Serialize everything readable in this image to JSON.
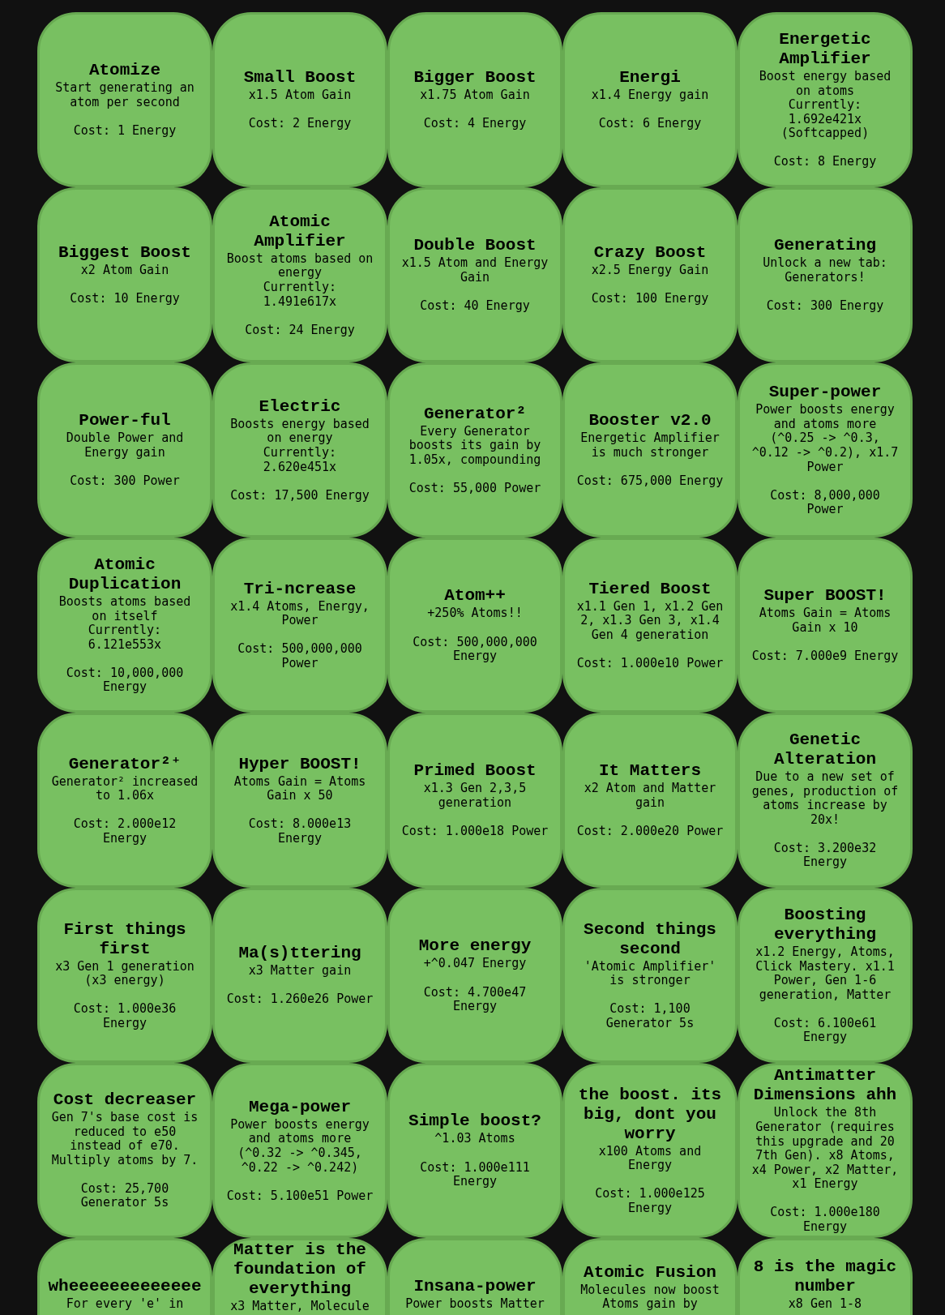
{
  "upgrades": [
    {
      "title": "Atomize",
      "description": "Start generating an atom per second",
      "cost": "Cost: 1 Energy"
    },
    {
      "title": "Small Boost",
      "description": "x1.5 Atom Gain",
      "cost": "Cost: 2 Energy"
    },
    {
      "title": "Bigger Boost",
      "description": "x1.75 Atom Gain",
      "cost": "Cost: 4 Energy"
    },
    {
      "title": "Energi",
      "description": "x1.4 Energy gain",
      "cost": "Cost: 6 Energy"
    },
    {
      "title": "Energetic Amplifier",
      "description": "Boost energy based on atoms",
      "effect": "Currently: 1.692e421x (Softcapped)",
      "cost": "Cost: 8 Energy"
    },
    {
      "title": "Biggest Boost",
      "description": "x2 Atom Gain",
      "cost": "Cost: 10 Energy"
    },
    {
      "title": "Atomic Amplifier",
      "description": "Boost atoms based on energy",
      "effect": "Currently: 1.491e617x",
      "cost": "Cost: 24 Energy"
    },
    {
      "title": "Double Boost",
      "description": "x1.5 Atom and Energy Gain",
      "cost": "Cost: 40 Energy"
    },
    {
      "title": "Crazy Boost",
      "description": "x2.5 Energy Gain",
      "cost": "Cost: 100 Energy"
    },
    {
      "title": "Generating",
      "description": "Unlock a new tab: Generators!",
      "cost": "Cost: 300 Energy"
    },
    {
      "title": "Power-ful",
      "description": "Double Power and Energy gain",
      "cost": "Cost: 300 Power"
    },
    {
      "title": "Electric",
      "description": "Boosts energy based on energy",
      "effect": "Currently: 2.620e451x",
      "cost": "Cost: 17,500 Energy"
    },
    {
      "title": "Generator²",
      "description": "Every Generator boosts its gain by 1.05x, compounding",
      "cost": "Cost: 55,000 Power"
    },
    {
      "title": "Booster v2.0",
      "description": "Energetic Amplifier is much stronger",
      "cost": "Cost: 675,000 Energy"
    },
    {
      "title": "Super-power",
      "description": "Power boosts energy and atoms more (^0.25 -> ^0.3, ^0.12 -> ^0.2), x1.7 Power",
      "cost": "Cost: 8,000,000 Power"
    },
    {
      "title": "Atomic Duplication",
      "description": "Boosts atoms based on itself",
      "effect": "Currently: 6.121e553x",
      "cost": "Cost: 10,000,000 Energy"
    },
    {
      "title": "Tri-ncrease",
      "description": "x1.4 Atoms, Energy, Power",
      "cost": "Cost: 500,000,000 Power"
    },
    {
      "title": "Atom++",
      "description": "+250% Atoms!!",
      "cost": "Cost: 500,000,000 Energy"
    },
    {
      "title": "Tiered Boost",
      "description": "x1.1 Gen 1, x1.2 Gen 2, x1.3 Gen 3, x1.4 Gen 4 generation",
      "cost": "Cost: 1.000e10 Power"
    },
    {
      "title": "Super BOOST!",
      "description": "Atoms Gain = Atoms Gain x 10",
      "cost": "Cost: 7.000e9 Energy"
    },
    {
      "title": "Generator²⁺",
      "description": "Generator² increased to 1.06x",
      "cost": "Cost: 2.000e12 Energy"
    },
    {
      "title": "Hyper BOOST!",
      "description": "Atoms Gain = Atoms Gain x 50",
      "cost": "Cost: 8.000e13 Energy"
    },
    {
      "title": "Primed Boost",
      "description": "x1.3 Gen 2,3,5 generation",
      "cost": "Cost: 1.000e18 Power"
    },
    {
      "title": "It Matters",
      "description": "x2 Atom and Matter gain",
      "cost": "Cost: 2.000e20 Power"
    },
    {
      "title": "Genetic Alteration",
      "description": "Due to a new set of genes, production of atoms increase by 20x!",
      "cost": "Cost: 3.200e32 Energy"
    },
    {
      "title": "First things first",
      "description": "x3 Gen 1 generation (x3 energy)",
      "cost": "Cost: 1.000e36 Energy"
    },
    {
      "title": "Ma(s)ttering",
      "description": "x3 Matter gain",
      "cost": "Cost: 1.260e26 Power"
    },
    {
      "title": "More energy",
      "description": "+^0.047 Energy",
      "cost": "Cost: 4.700e47 Energy"
    },
    {
      "title": "Second things second",
      "description": "'Atomic Amplifier' is stronger",
      "cost": "Cost: 1,100 Generator 5s"
    },
    {
      "title": "Boosting everything",
      "description": "x1.2 Energy, Atoms, Click Mastery. x1.1 Power, Gen 1-6 generation, Matter",
      "cost": "Cost: 6.100e61 Energy"
    },
    {
      "title": "Cost decreaser",
      "description": "Gen 7's base cost is reduced to e50 instead of e70. Multiply atoms by 7.",
      "cost": "Cost: 25,700 Generator 5s"
    },
    {
      "title": "Mega-power",
      "description": "Power boosts energy and atoms more (^0.32 -> ^0.345, ^0.22 -> ^0.242)",
      "cost": "Cost: 5.100e51 Power"
    },
    {
      "title": "Simple boost?",
      "description": "^1.03 Atoms",
      "cost": "Cost: 1.000e111 Energy"
    },
    {
      "title": "the boost. its big, dont you worry",
      "description": "x100 Atoms and Energy",
      "cost": "Cost: 1.000e125 Energy"
    },
    {
      "title": "Antimatter Dimensions ahh",
      "description": "Unlock the 8th Generator (requires this upgrade and 20 7th Gen). x8 Atoms, x4 Power, x2 Matter, x1 Energy",
      "cost": "Cost: 1.000e180 Energy"
    },
    {
      "title": "wheeeeeeeeeeeee",
      "description": "For every 'e' in"
    },
    {
      "title": "Matter is the foundation of everything",
      "description": "x3 Matter, Molecule"
    },
    {
      "title": "Insana-power",
      "description": "Power boosts Matter"
    },
    {
      "title": "Atomic Fusion",
      "description": "Molecules now boost Atoms gain by"
    },
    {
      "title": "8 is the magic number",
      "description": "x8 Gen 1-8"
    }
  ]
}
